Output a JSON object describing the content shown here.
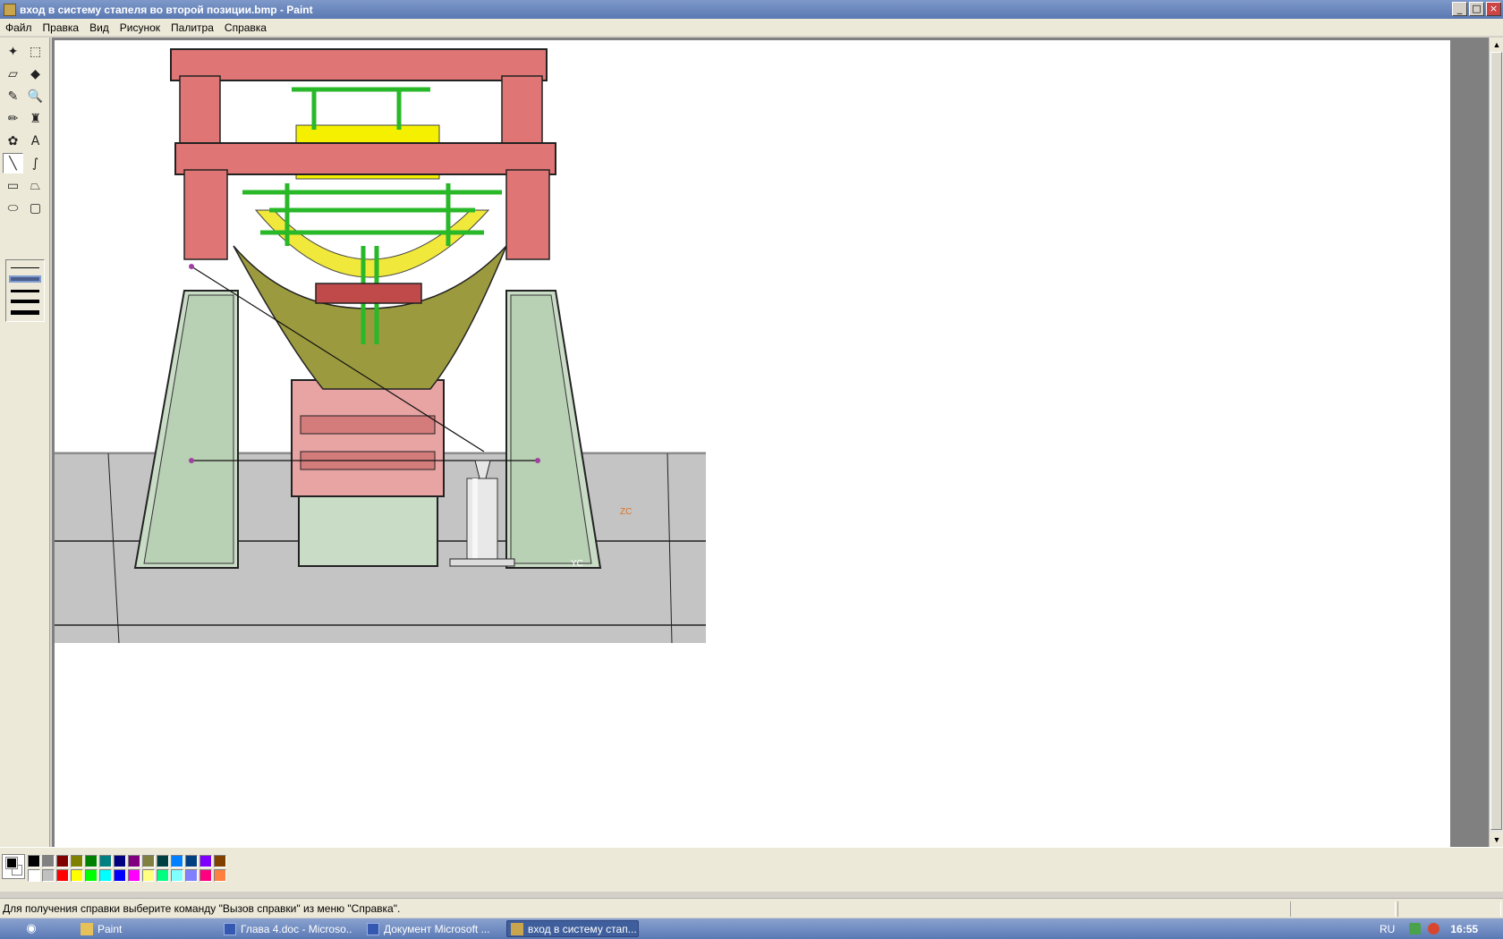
{
  "window": {
    "title": "вход в систему стапеля во второй  позиции.bmp - Paint",
    "buttons": {
      "minimize": "_",
      "maximize": "□",
      "close": "×"
    }
  },
  "menu": [
    "Файл",
    "Правка",
    "Вид",
    "Рисунок",
    "Палитра",
    "Справка"
  ],
  "tools": [
    {
      "name": "free-select-icon",
      "glyph": "✦"
    },
    {
      "name": "rect-select-icon",
      "glyph": "⬚"
    },
    {
      "name": "eraser-icon",
      "glyph": "▱"
    },
    {
      "name": "fill-icon",
      "glyph": "◆"
    },
    {
      "name": "color-picker-icon",
      "glyph": "✎"
    },
    {
      "name": "magnifier-icon",
      "glyph": "🔍"
    },
    {
      "name": "pencil-icon",
      "glyph": "✏"
    },
    {
      "name": "brush-icon",
      "glyph": "♜"
    },
    {
      "name": "airbrush-icon",
      "glyph": "✿"
    },
    {
      "name": "text-icon",
      "glyph": "A"
    },
    {
      "name": "line-icon",
      "glyph": "╲"
    },
    {
      "name": "curve-icon",
      "glyph": "∫"
    },
    {
      "name": "rectangle-icon",
      "glyph": "▭"
    },
    {
      "name": "polygon-icon",
      "glyph": "⏢"
    },
    {
      "name": "ellipse-icon",
      "glyph": "⬭"
    },
    {
      "name": "rounded-rect-icon",
      "glyph": "▢"
    }
  ],
  "palette": {
    "row1": [
      "#000000",
      "#808080",
      "#800000",
      "#808000",
      "#008000",
      "#008080",
      "#000080",
      "#800080",
      "#808040",
      "#004040",
      "#0080ff",
      "#004080",
      "#8000ff",
      "#804000"
    ],
    "row2": [
      "#ffffff",
      "#c0c0c0",
      "#ff0000",
      "#ffff00",
      "#00ff00",
      "#00ffff",
      "#0000ff",
      "#ff00ff",
      "#ffff80",
      "#00ff80",
      "#80ffff",
      "#8080ff",
      "#ff0080",
      "#ff8040"
    ]
  },
  "status": {
    "text": "Для получения справки выберите команду \"Вызов справки\" из меню \"Справка\"."
  },
  "image": {
    "axis_label_1": "ZC",
    "axis_label_2": "YC"
  },
  "taskbar": {
    "tasks": [
      {
        "label": "Paint",
        "icon": "folder-icon"
      },
      {
        "label": "Глава 4.doc - Microso...",
        "icon": "word-icon"
      },
      {
        "label": "Документ Microsoft ...",
        "icon": "word-icon"
      },
      {
        "label": "вход в систему стап...",
        "icon": "paint-icon"
      }
    ],
    "lang": "RU",
    "clock": "16:55"
  }
}
